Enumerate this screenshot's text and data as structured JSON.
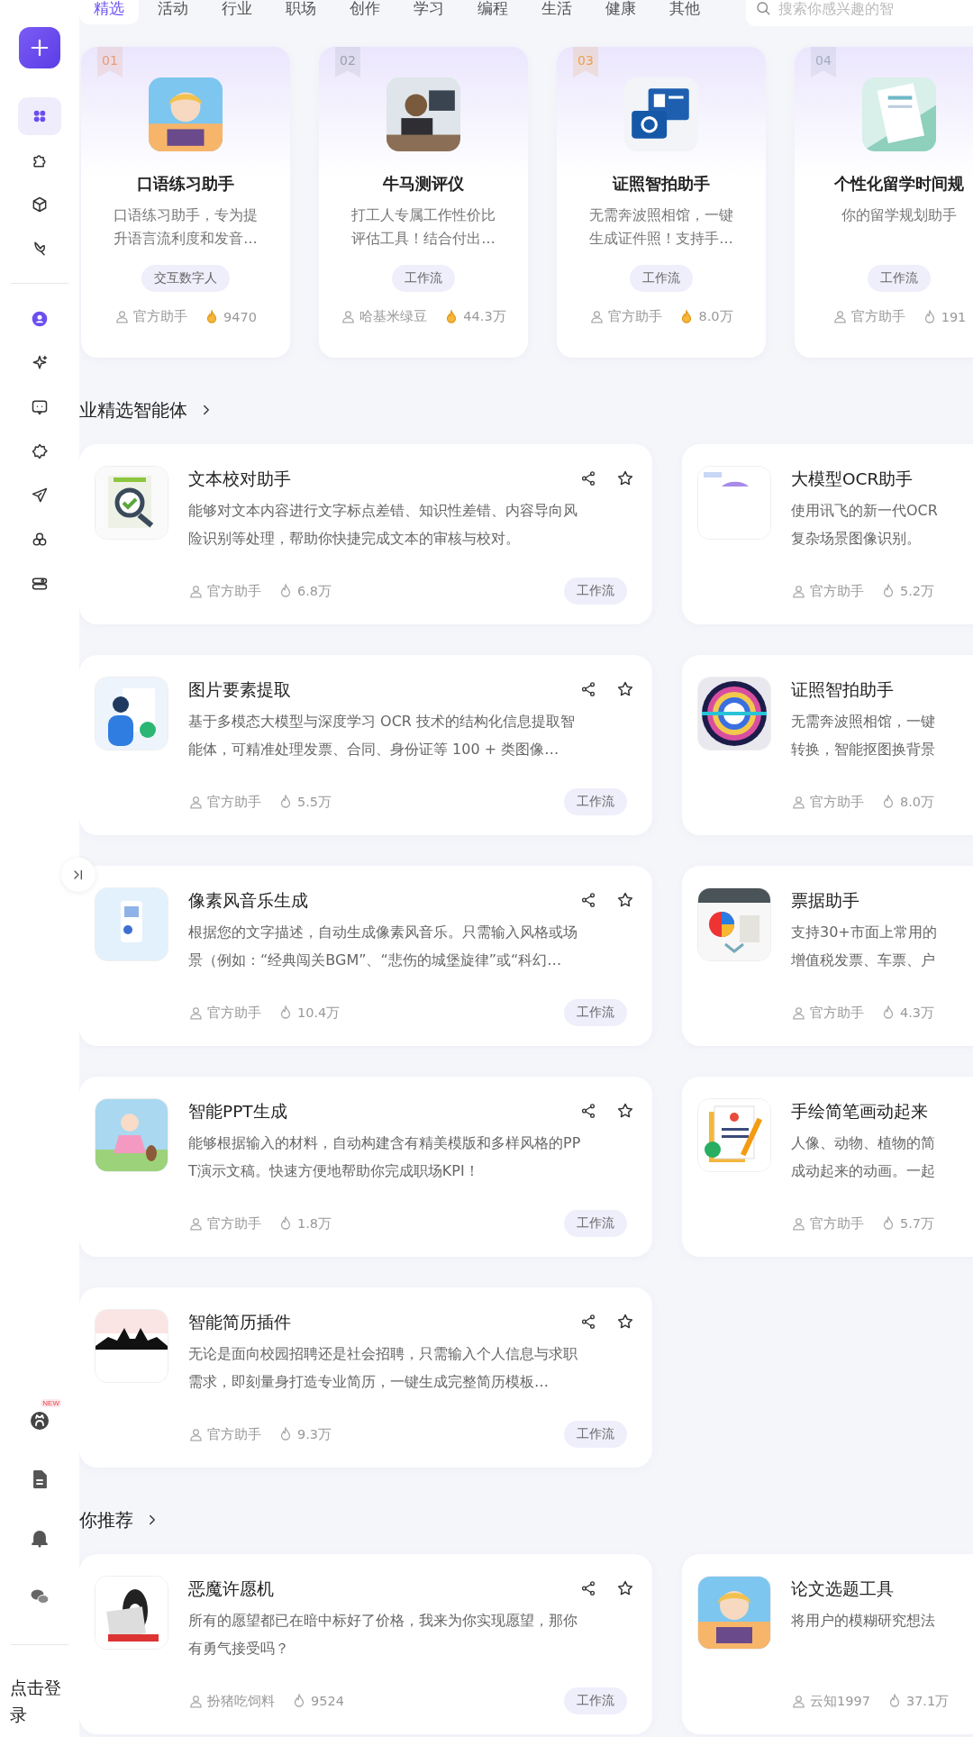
{
  "sidebar": {
    "items": [
      {
        "selected": true
      },
      {
        "selected": false
      },
      {
        "selected": false
      },
      {
        "selected": false
      },
      {
        "selected": false
      },
      {
        "selected": false
      },
      {
        "selected": false
      },
      {
        "selected": false
      },
      {
        "selected": false
      },
      {
        "selected": false
      },
      {
        "selected": false
      }
    ],
    "new_badge": "NEW",
    "login": "点击登录"
  },
  "tabs": [
    {
      "label": "精选",
      "selected": true
    },
    {
      "label": "活动",
      "selected": false
    },
    {
      "label": "行业",
      "selected": false
    },
    {
      "label": "职场",
      "selected": false
    },
    {
      "label": "创作",
      "selected": false
    },
    {
      "label": "学习",
      "selected": false
    },
    {
      "label": "编程",
      "selected": false
    },
    {
      "label": "生活",
      "selected": false
    },
    {
      "label": "健康",
      "selected": false
    },
    {
      "label": "其他",
      "selected": false
    }
  ],
  "search": {
    "placeholder": "搜索你感兴趣的智"
  },
  "featured": [
    {
      "rank": "01",
      "color": "#e59b78",
      "title": "口语练习助手",
      "desc": "口语练习助手，专为提升语言流利度和发音…",
      "tag": "交互数字人",
      "author": "官方助手",
      "count": "9470",
      "hot": true
    },
    {
      "rank": "02",
      "color": "#9aa0ad",
      "title": "牛马测评仪",
      "desc": "打工人专属工作性价比评估工具！结合付出…",
      "tag": "工作流",
      "author": "哈基米绿豆",
      "count": "44.3万",
      "hot": true
    },
    {
      "rank": "03",
      "color": "#e8a04e",
      "title": "证照智拍助手",
      "desc": "无需奔波照相馆，一键生成证件照！支持手…",
      "tag": "工作流",
      "author": "官方助手",
      "count": "8.0万",
      "hot": true
    },
    {
      "rank": "04",
      "color": "#a3acc4",
      "title": "个性化留学时间规",
      "desc": "你的留学规划助手",
      "tag": "工作流",
      "author": "官方助手",
      "count": "191",
      "hot": false
    }
  ],
  "sections": [
    {
      "heading": "业精选智能体",
      "rows": [
        {
          "left": {
            "title": "文本校对助手",
            "desc": "能够对文本内容进行文字标点差错、知识性差错、内容导向风险识别等处理，帮助你快捷完成文本的审核与校对。",
            "author": "官方助手",
            "count": "6.8万",
            "tag": "工作流"
          },
          "right": {
            "title": "大模型OCR助手",
            "desc": "使用讯飞的新一代OCR复杂场景图像识别。",
            "author": "官方助手",
            "count": "5.2万"
          }
        },
        {
          "left": {
            "title": "图片要素提取",
            "desc": "基于多模态大模型与深度学习 OCR 技术的结构化信息提取智能体，可精准处理发票、合同、身份证等 100 + 类图像…",
            "author": "官方助手",
            "count": "5.5万",
            "tag": "工作流"
          },
          "right": {
            "title": "证照智拍助手",
            "desc": "无需奔波照相馆，一键转换，智能抠图换背景",
            "author": "官方助手",
            "count": "8.0万"
          }
        },
        {
          "left": {
            "title": "像素风音乐生成",
            "desc": "根据您的文字描述，自动生成像素风音乐。只需输入风格或场景（例如：“经典闯关BGM”、“悲伤的城堡旋律”或“科幻…",
            "author": "官方助手",
            "count": "10.4万",
            "tag": "工作流"
          },
          "right": {
            "title": "票据助手",
            "desc": "支持30+市面上常用的增值税发票、车票、户",
            "author": "官方助手",
            "count": "4.3万"
          }
        },
        {
          "left": {
            "title": "智能PPT生成",
            "desc": "能够根据输入的材料，自动构建含有精美模版和多样风格的PPT演示文稿。快速方便地帮助你完成职场KPI！",
            "author": "官方助手",
            "count": "1.8万",
            "tag": "工作流"
          },
          "right": {
            "title": "手绘简笔画动起来",
            "desc": "人像、动物、植物的简成动起来的动画。一起",
            "author": "官方助手",
            "count": "5.7万"
          }
        },
        {
          "left": {
            "title": "智能简历插件",
            "desc": "无论是面向校园招聘还是社会招聘，只需输入个人信息与求职需求，即刻量身打造专业简历，一键生成完整简历模板…",
            "author": "官方助手",
            "count": "9.3万",
            "tag": "工作流"
          }
        }
      ]
    },
    {
      "heading": "你推荐",
      "rows": [
        {
          "left": {
            "title": "恶魔许愿机",
            "desc": "所有的愿望都已在暗中标好了价格，我来为你实现愿望，那你有勇气接受吗？",
            "author": "扮猪吃饲料",
            "count": "9524",
            "tag": "工作流"
          },
          "right": {
            "title": "论文选题工具",
            "desc": "将用户的模糊研究想法",
            "author": "云知1997",
            "count": "37.1万"
          }
        }
      ]
    }
  ]
}
